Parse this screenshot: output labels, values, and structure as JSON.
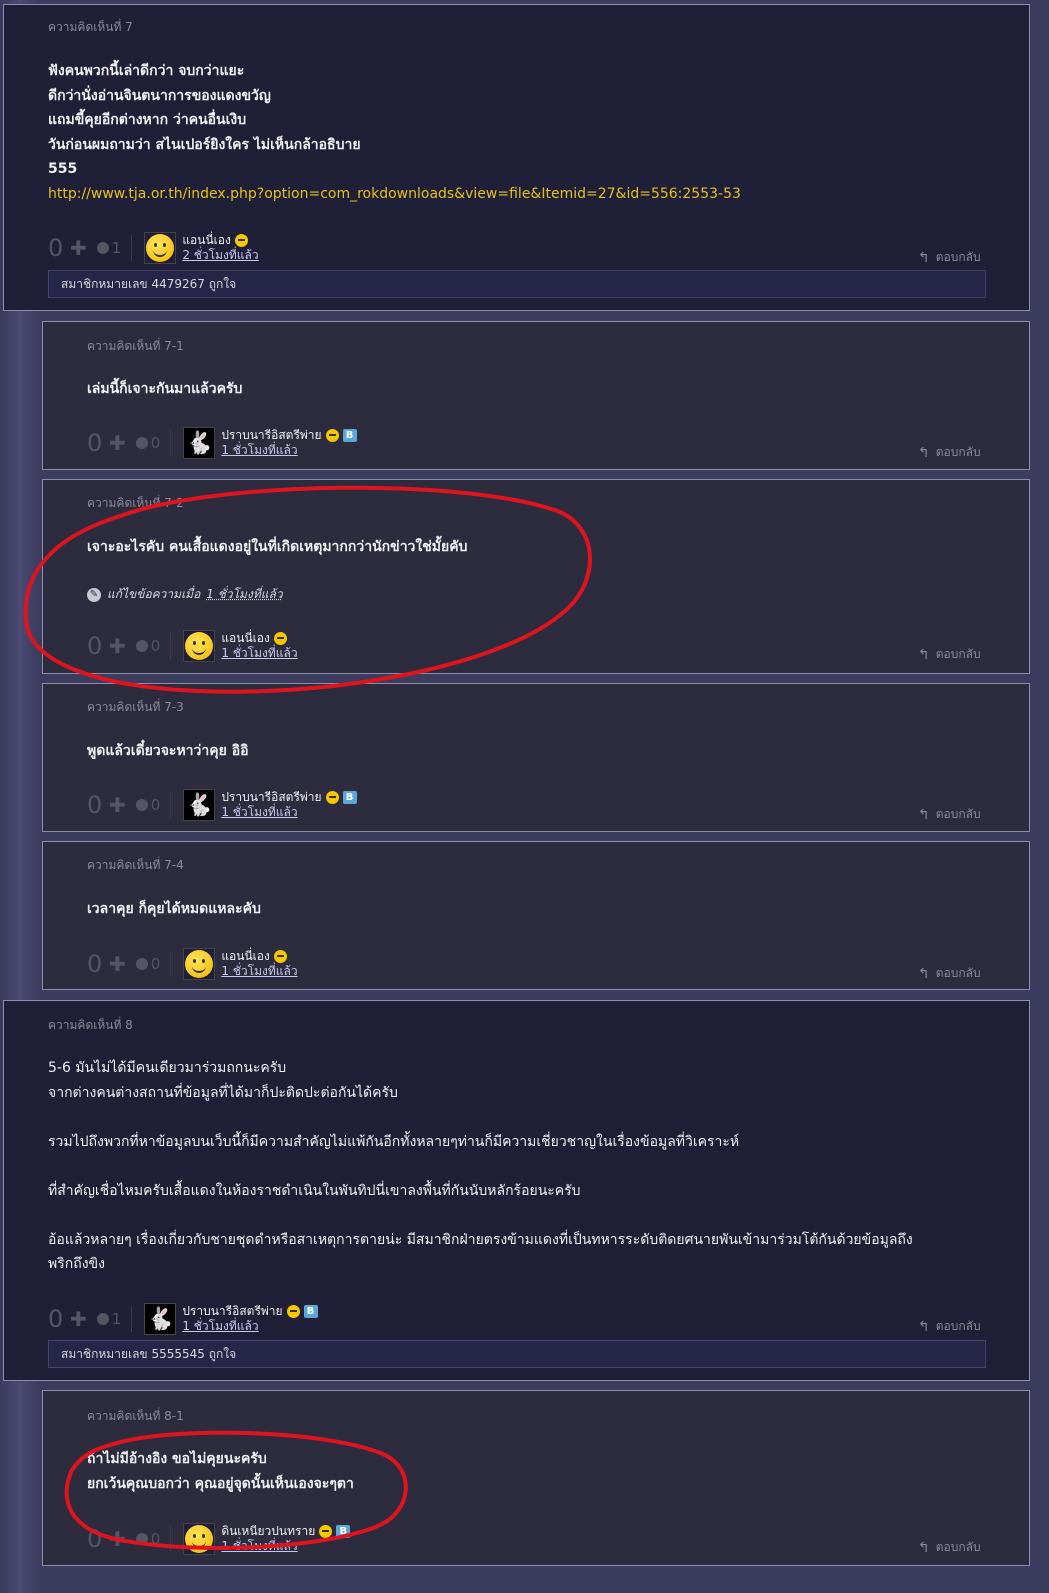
{
  "c7": {
    "label": "ความคิดเห็นที่ 7",
    "lines": [
      "ฟังคนพวกนี้เล่าดีกว่า     จบกว่าแยะ",
      "ดีกว่านั่งอ่านจินตนาการของแดงขวัญ",
      "แถมขี้คุยอีกต่างหาก ว่าคนอื่นเงิบ",
      "วันก่อนผมถามว่า สไนเปอร์ยิงใคร ไม่เห็นกล้าอธิบาย",
      "555"
    ],
    "link": "http://www.tja.or.th/index.php?option=com_rokdownloads&view=file&Itemid=27&id=556:2553-53",
    "score": "0",
    "emotion": "1",
    "author": "แอนนี่เอง",
    "time": "2 ชั่วโมงที่แล้ว",
    "reply": "ตอบกลับ",
    "member_note": "สมาชิกหมายเลข 4479267 ถูกใจ"
  },
  "c7_1": {
    "label": "ความคิดเห็นที่ 7-1",
    "text": "เล่มนี้ก็เจาะกันมาแล้วครับ",
    "score": "0",
    "emotion": "0",
    "author": "ปราบนารีอิสตรีพ่าย",
    "time": "1 ชั่วโมงที่แล้ว",
    "reply": "ตอบกลับ"
  },
  "c7_2": {
    "label": "ความคิดเห็นที่ 7-2",
    "text": "เจาะอะไรคับ คนเสื้อแดงอยู่ในที่เกิดเหตุมากกว่านักข่าวใช่มั้ยคับ",
    "edit_prefix": "แก้ไขข้อความเมื่อ",
    "edit_time": "1 ชั่วโมงที่แล้ว",
    "score": "0",
    "emotion": "0",
    "author": "แอนนี่เอง",
    "time": "1 ชั่วโมงที่แล้ว",
    "reply": "ตอบกลับ"
  },
  "c7_3": {
    "label": "ความคิดเห็นที่ 7-3",
    "text": "พูดแล้วเดี๋ยวจะหาว่าคุย อิอิ",
    "score": "0",
    "emotion": "0",
    "author": "ปราบนารีอิสตรีพ่าย",
    "time": "1 ชั่วโมงที่แล้ว",
    "reply": "ตอบกลับ"
  },
  "c7_4": {
    "label": "ความคิดเห็นที่ 7-4",
    "text": "เวลาคุย ก็คุยได้หมดแหละคับ",
    "score": "0",
    "emotion": "0",
    "author": "แอนนี่เอง",
    "time": "1 ชั่วโมงที่แล้ว",
    "reply": "ตอบกลับ"
  },
  "c8": {
    "label": "ความคิดเห็นที่ 8",
    "lines": [
      "5-6 มันไม่ได้มีคนเดียวมาร่วมถกนะครับ",
      "จากต่างคนต่างสถานที่ข้อมูลที่ได้มาก็ปะติดปะต่อกันได้ครับ",
      "",
      "รวมไปถึงพวกที่หาข้อมูลบนเว็บนี้ก็มีความสำคัญไม่แพ้กันอีกทั้งหลายๆท่านก็มีความเชี่ยวชาญในเรื่องข้อมูลที่วิเคราะห์",
      "",
      "ที่สำคัญเชื่อไหมครับเสื้อแดงในห้องราชดำเนินในพันทิปนี่เขาลงพื้นที่กันนับหลักร้อยนะครับ",
      "",
      "อ้อแล้วหลายๆ เรื่องเกี่ยวกับชายชุดดำหรือสาเหตุการตายน่ะ มีสมาชิกฝ่ายตรงข้ามแดงที่เป็นทหารระดับติดยศนายพันเข้ามาร่วมโต้กันด้วยข้อมูลถึง",
      "พริกถึงขิง"
    ],
    "score": "0",
    "emotion": "1",
    "author": "ปราบนารีอิสตรีพ่าย",
    "time": "1 ชั่วโมงที่แล้ว",
    "reply": "ตอบกลับ",
    "member_note": "สมาชิกหมายเลข 5555545 ถูกใจ"
  },
  "c8_1": {
    "label": "ความคิดเห็นที่ 8-1",
    "lines": [
      "ถ้าไม่มีอ้างอิง ขอไม่คุยนะครับ",
      "ยกเว้นคุณบอกว่า คุณอยู่จุดนั้นเห็นเองจะๆตา"
    ],
    "score": "0",
    "emotion": "0",
    "author": "ดินเหนียวปนทราย",
    "time": "1 ชั่วโมงที่แล้ว",
    "reply": "ตอบกลับ"
  },
  "icons": {
    "plus": "plus-icon",
    "emotion": "emotion-icon",
    "reply": "reply-arrow-icon",
    "badge": "smiley-badge-icon",
    "blog": "blog-badge-icon"
  },
  "colors": {
    "link": "#e6c11e",
    "annotation": "#e0141e",
    "main_bg": "#1f1f38",
    "reply_bg": "#2c2c3e"
  }
}
